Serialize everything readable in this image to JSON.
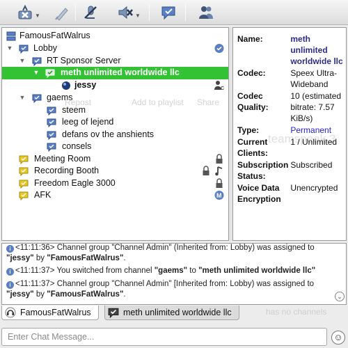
{
  "toolbar": {
    "buttons": [
      {
        "name": "disconnect",
        "icon": "disconnect-icon",
        "has_menu": true
      },
      {
        "name": "away",
        "icon": "away-icon",
        "has_menu": false
      },
      {
        "name": "mute-microphone",
        "icon": "mute-microphone-icon",
        "has_menu": false
      },
      {
        "name": "mute-speakers",
        "icon": "mute-speakers-icon",
        "has_menu": true
      },
      {
        "name": "chat",
        "icon": "chat-icon",
        "has_menu": false
      },
      {
        "name": "contacts",
        "icon": "contacts-icon",
        "has_menu": false
      }
    ]
  },
  "tree": {
    "server": "FamousFatWalrus",
    "channels": [
      {
        "label": "Lobby"
      },
      {
        "label": "RT Sponsor Server"
      },
      {
        "label": "meth unlimited worldwide llc"
      },
      {
        "label": "jessy"
      },
      {
        "label": "gaems"
      },
      {
        "label": "steem"
      },
      {
        "label": "leeg of lejend"
      },
      {
        "label": "defans ov the anshients"
      },
      {
        "label": "consels"
      },
      {
        "label": "Meeting Room"
      },
      {
        "label": "Recording Booth"
      },
      {
        "label": "Freedom Eagle 3000"
      },
      {
        "label": "AFK"
      }
    ]
  },
  "info": {
    "rows": [
      {
        "key": "Name:",
        "value": "meth unlimited worldwide llc"
      },
      {
        "key": "Codec:",
        "value": "Speex Ultra-Wideband"
      },
      {
        "key": "Codec Quality:",
        "value": "10 (estimated bitrate: 7.57 KiB/s)"
      },
      {
        "key": "Type:",
        "value": "Permanent"
      },
      {
        "key": "Current Clients:",
        "value": "1 / Unlimited"
      },
      {
        "key": "Subscription Status:",
        "value": "Subscribed"
      },
      {
        "key": "Voice Data Encryption",
        "value": "Unencrypted"
      }
    ]
  },
  "ghost": {
    "post": "Repost",
    "playlist": "Add to playlist",
    "share": "Share",
    "logo": "teamspeak 3",
    "no_channels": "has no channels"
  },
  "log": {
    "line0": {
      "time": "<11:11:36>",
      "text_a": "Channel group \"Channel Admin\" (Inherited from: Lobby) was assigned to"
    },
    "line1": {
      "user": "\"jessy\"",
      "by": "by",
      "assigner": "\"FamousFatWalrus\"",
      "end": "."
    },
    "line2": {
      "time": "<11:11:37>",
      "text_a": "You switched from channel",
      "from": "\"gaems\"",
      "to_word": "to",
      "to": "\"meth unlimited worldwide llc\""
    },
    "line3": {
      "time": "<11:11:37>",
      "text_a": "Channel group \"Channel Admin\" [Inherited from: Lobby) was assigned to"
    },
    "line4": {
      "user": "\"jessy\"",
      "by": "by",
      "assigner": "\"FamousFatWalrus\"",
      "end": "."
    }
  },
  "tabs": [
    {
      "label": "FamousFatWalrus",
      "active": true
    },
    {
      "label": "meth unlimited worldwide llc",
      "active": false
    }
  ],
  "chat": {
    "placeholder": "Enter Chat Message...",
    "emoji": "☺"
  },
  "colors": {
    "selected_row": "#33c233",
    "channel_icon": "#5b7fc4",
    "subscribed_badge": "#e8c81e",
    "link": "#2323c8"
  }
}
